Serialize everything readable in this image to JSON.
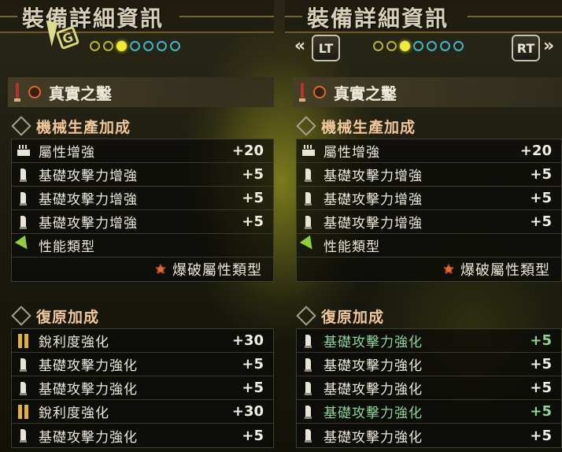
{
  "panels": [
    {
      "title": "裝備詳細資訊",
      "weapon_name": "真實之鑿",
      "sections": {
        "machine": {
          "label": "機械生產加成",
          "rows": [
            {
              "label": "屬性增強",
              "value": "+20",
              "icon": "element-icon"
            },
            {
              "label": "基礎攻擊力增強",
              "value": "+5",
              "icon": "attack-icon"
            },
            {
              "label": "基礎攻擊力增強",
              "value": "+5",
              "icon": "attack-icon"
            },
            {
              "label": "基礎攻擊力增強",
              "value": "+5",
              "icon": "attack-icon"
            },
            {
              "label": "性能類型",
              "value": "",
              "icon": "performance-icon"
            }
          ],
          "type_value": "爆破屬性類型"
        },
        "restore": {
          "label": "復原加成",
          "rows": [
            {
              "label": "銳利度強化",
              "value": "+30",
              "icon": "sharpness-icon"
            },
            {
              "label": "基礎攻擊力強化",
              "value": "+5",
              "icon": "attack-icon"
            },
            {
              "label": "基礎攻擊力強化",
              "value": "+5",
              "icon": "attack-icon"
            },
            {
              "label": "銳利度強化",
              "value": "+30",
              "icon": "sharpness-icon"
            },
            {
              "label": "基礎攻擊力強化",
              "value": "+5",
              "icon": "attack-icon"
            }
          ]
        }
      }
    },
    {
      "title": "裝備詳細資訊",
      "weapon_name": "真實之鑿",
      "nav_left": "LT",
      "nav_right": "RT",
      "nav_left_chevron": "«",
      "nav_right_chevron": "»",
      "sections": {
        "machine": {
          "label": "機械生產加成",
          "rows": [
            {
              "label": "屬性增強",
              "value": "+20",
              "icon": "element-icon"
            },
            {
              "label": "基礎攻擊力增強",
              "value": "+5",
              "icon": "attack-icon"
            },
            {
              "label": "基礎攻擊力增強",
              "value": "+5",
              "icon": "attack-icon"
            },
            {
              "label": "基礎攻擊力增強",
              "value": "+5",
              "icon": "attack-icon"
            },
            {
              "label": "性能類型",
              "value": "",
              "icon": "performance-icon"
            }
          ],
          "type_value": "爆破屬性類型"
        },
        "restore": {
          "label": "復原加成",
          "rows": [
            {
              "label": "基礎攻擊力強化",
              "value": "+5",
              "icon": "attack-icon",
              "highlight": true
            },
            {
              "label": "基礎攻擊力強化",
              "value": "+5",
              "icon": "attack-icon"
            },
            {
              "label": "基礎攻擊力強化",
              "value": "+5",
              "icon": "attack-icon"
            },
            {
              "label": "基礎攻擊力強化",
              "value": "+5",
              "icon": "attack-icon",
              "highlight": true
            },
            {
              "label": "基礎攻擊力強化",
              "value": "+5",
              "icon": "attack-icon"
            }
          ]
        }
      }
    }
  ],
  "pager": {
    "total": 7,
    "active_index": 2
  },
  "colors": {
    "accent_yellow": "#f1ec3a",
    "pager_blue": "#3fb5c9",
    "section_label": "#f0c79c",
    "highlight_green": "#8fd39a"
  }
}
